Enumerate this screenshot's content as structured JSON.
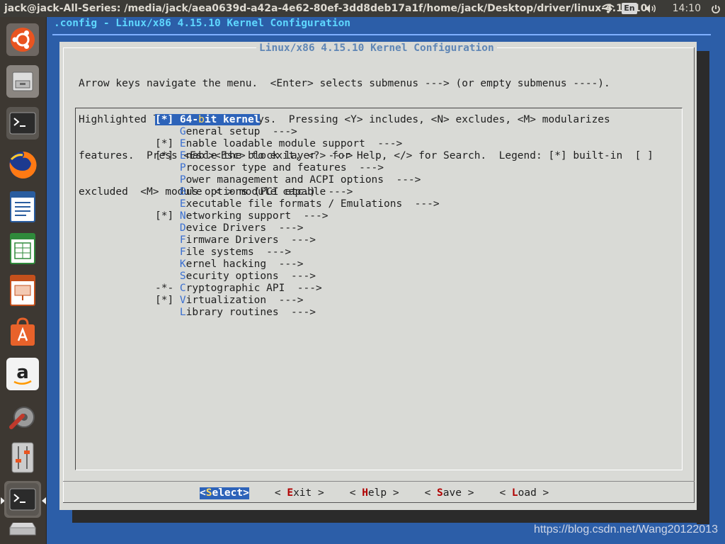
{
  "topbar": {
    "window_title": "jack@jack-All-Series: /media/jack/aea0639d-a42a-4e62-80ef-3dd8deb17a1f/home/jack/Desktop/driver/linux-4.15.10",
    "lang": "En",
    "clock": "14:10",
    "icons": [
      "wifi-icon",
      "volume-icon",
      "power-icon"
    ]
  },
  "launcher": {
    "items": [
      "ubuntu-dash",
      "files",
      "terminal",
      "firefox",
      "libreoffice-writer",
      "libreoffice-calc",
      "libreoffice-impress",
      "software-center",
      "amazon",
      "system-settings",
      "mixer",
      "terminal-running",
      "drive"
    ]
  },
  "terminal": {
    "header": ".config - Linux/x86 4.15.10 Kernel Configuration"
  },
  "dialog": {
    "title": "Linux/x86 4.15.10 Kernel Configuration",
    "help_lines": [
      "Arrow keys navigate the menu.  <Enter> selects submenus ---> (or empty submenus ----).",
      "Highlighted letters are hotkeys.  Pressing <Y> includes, <N> excludes, <M> modularizes",
      "features.  Press <Esc><Esc> to exit, <?> for Help, </> for Search.  Legend: [*] built-in  [ ]",
      "excluded  <M> module  < > module capable"
    ],
    "menu": [
      {
        "prefix": "[*]",
        "hotkey": "6",
        "rest": "4-bit kernel",
        "hotkey_index": 3,
        "selected": true
      },
      {
        "prefix": "   ",
        "hotkey": "G",
        "rest": "eneral setup  --->"
      },
      {
        "prefix": "[*]",
        "hotkey": "E",
        "rest": "nable loadable module support  --->"
      },
      {
        "prefix": "[*]",
        "hotkey": "E",
        "rest": "nable the block layer  --->"
      },
      {
        "prefix": "   ",
        "hotkey": "P",
        "rest": "rocessor type and features  --->"
      },
      {
        "prefix": "   ",
        "hotkey": "P",
        "rest": "ower management and ACPI options  --->"
      },
      {
        "prefix": "   ",
        "hotkey": "B",
        "rest": "us options (PCI etc.)  --->"
      },
      {
        "prefix": "   ",
        "hotkey": "E",
        "rest": "xecutable file formats / Emulations  --->"
      },
      {
        "prefix": "[*]",
        "hotkey": "N",
        "rest": "etworking support  --->"
      },
      {
        "prefix": "   ",
        "hotkey": "D",
        "rest": "evice Drivers  --->"
      },
      {
        "prefix": "   ",
        "hotkey": "F",
        "rest": "irmware Drivers  --->"
      },
      {
        "prefix": "   ",
        "hotkey": "F",
        "rest": "ile systems  --->"
      },
      {
        "prefix": "   ",
        "hotkey": "K",
        "rest": "ernel hacking  --->"
      },
      {
        "prefix": "   ",
        "hotkey": "S",
        "rest": "ecurity options  --->"
      },
      {
        "prefix": "-*-",
        "hotkey": "C",
        "rest": "ryptographic API  --->"
      },
      {
        "prefix": "[*]",
        "hotkey": "V",
        "rest": "irtualization  --->"
      },
      {
        "prefix": "   ",
        "hotkey": "L",
        "rest": "ibrary routines  --->"
      }
    ],
    "selected_label": "64-bit kernel",
    "buttons": [
      {
        "pre": "<",
        "key": "S",
        "post": "elect>",
        "selected": true
      },
      {
        "pre": "< ",
        "key": "E",
        "post": "xit >"
      },
      {
        "pre": "< ",
        "key": "H",
        "post": "elp >"
      },
      {
        "pre": "< ",
        "key": "S",
        "post": "ave >"
      },
      {
        "pre": "< ",
        "key": "L",
        "post": "oad >"
      }
    ]
  },
  "watermark": "https://blog.csdn.net/Wang20122013",
  "colors": {
    "terminal_bg": "#2c5ea8",
    "dialog_bg": "#d9dad6",
    "highlight": "#2d63b9",
    "hotkey": "#3a6fd0",
    "button_hotkey": "#b00000"
  }
}
